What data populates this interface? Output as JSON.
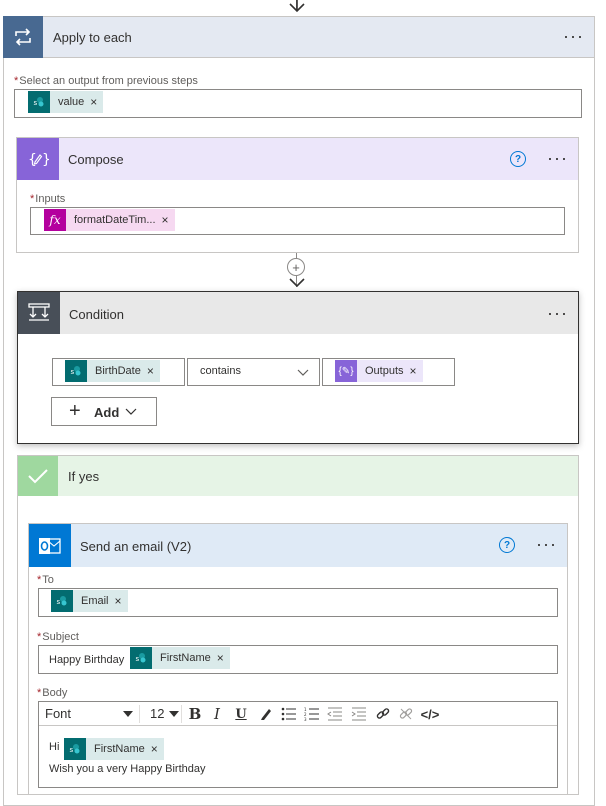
{
  "apply_to_each": {
    "title": "Apply to each",
    "select_label": "Select an output from previous steps",
    "token": "value"
  },
  "compose": {
    "title": "Compose",
    "inputs_label": "Inputs",
    "token": "formatDateTim..."
  },
  "condition": {
    "title": "Condition",
    "left_token": "BirthDate",
    "operator": "contains",
    "right_token": "Outputs",
    "add_label": "Add"
  },
  "if_yes": {
    "title": "If yes"
  },
  "send_email": {
    "title": "Send an email (V2)",
    "to_label": "To",
    "to_token": "Email",
    "subject_label": "Subject",
    "subject_text": "Happy Birthday",
    "subject_token": "FirstName",
    "body_label": "Body",
    "font_select": "Font",
    "size_select": "12",
    "body_hi": "Hi",
    "body_token": "FirstName",
    "body_line2": "Wish you a very Happy Birthday",
    "toolbar": {
      "bold": "B",
      "italic": "I",
      "underline": "U",
      "code_view": "</>"
    }
  },
  "common": {
    "close_glyph": "×",
    "more_glyph": "···",
    "help_glyph": "?",
    "required_mark": "*",
    "plus_glyph": "+"
  },
  "colors": {
    "apply_to_each": "#486991",
    "compose": "#8764d8",
    "condition": "#484f58",
    "if_yes": "#9fd89f",
    "outlook": "#0078d4",
    "sharepoint": "#036c70",
    "expression": "#b4009e"
  },
  "icons": {
    "apply_to_each": "loop-icon",
    "compose": "compose-icon",
    "condition": "condition-icon",
    "if_yes": "checkmark-icon",
    "send_email": "outlook-icon",
    "token": "sharepoint-icon",
    "expression": "fx-icon"
  }
}
